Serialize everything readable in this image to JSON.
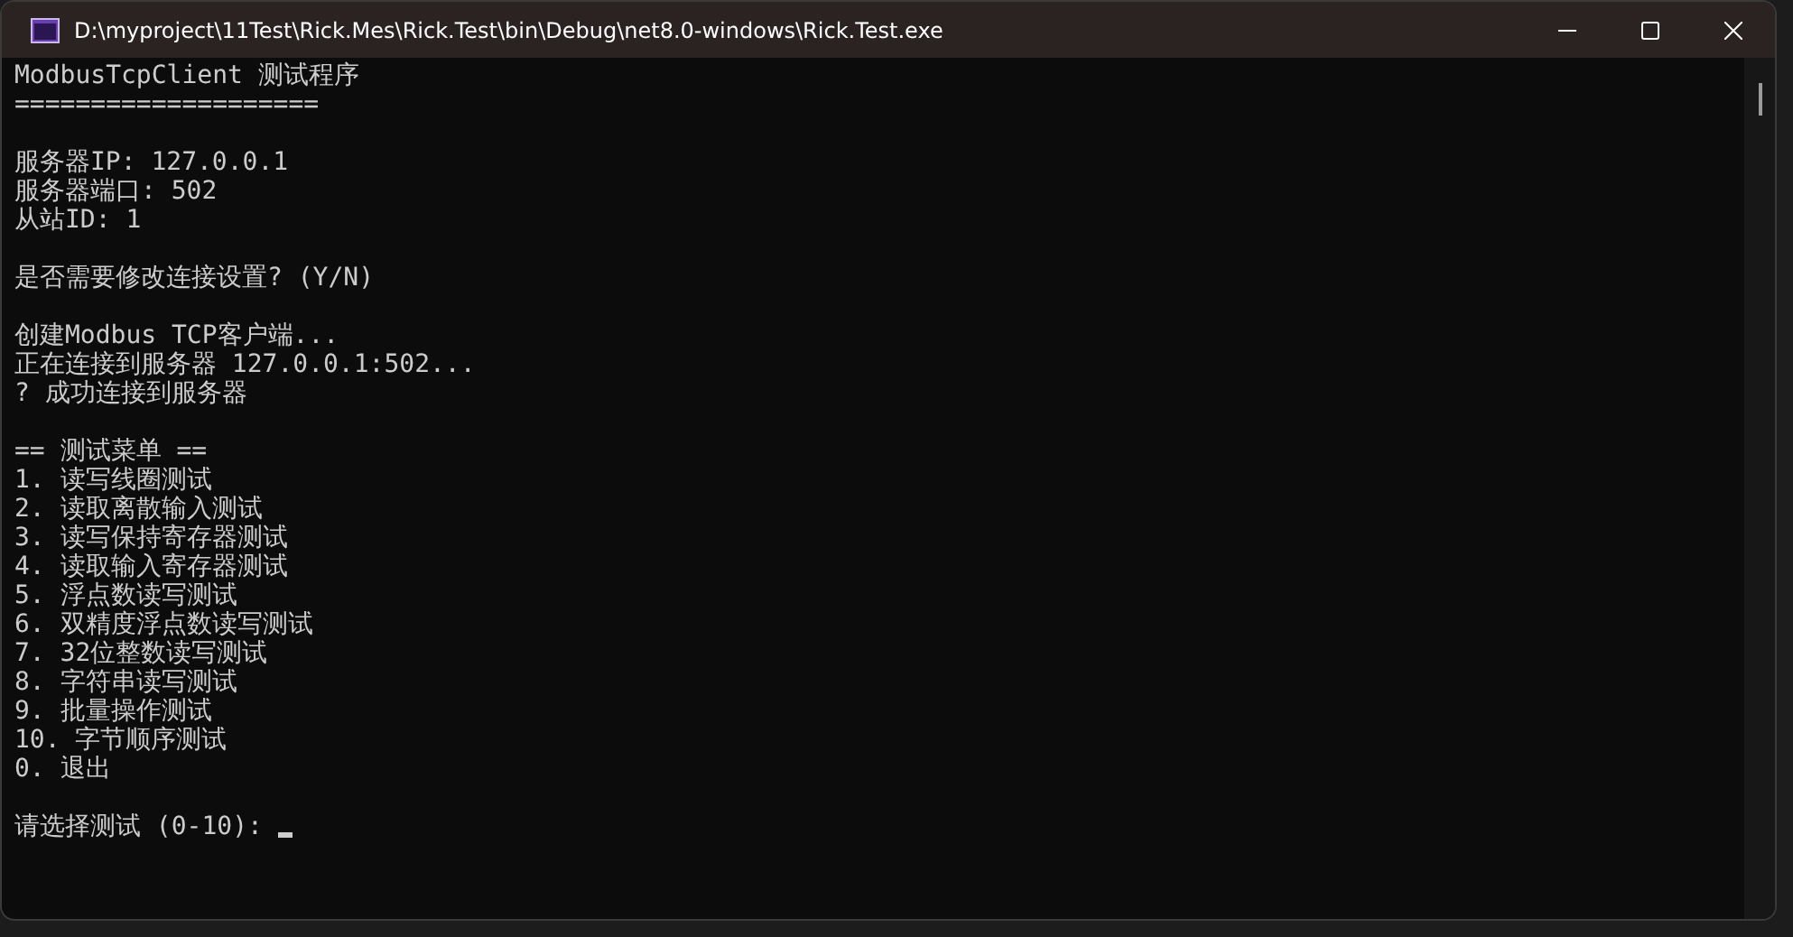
{
  "window": {
    "title": "D:\\myproject\\11Test\\Rick.Mes\\Rick.Test\\bin\\Debug\\net8.0-windows\\Rick.Test.exe"
  },
  "console": {
    "blocks": [
      [
        "ModbusTcpClient 测试程序",
        "===================="
      ],
      [
        "服务器IP: 127.0.0.1",
        "服务器端口: 502",
        "从站ID: 1"
      ],
      [
        "是否需要修改连接设置? (Y/N)"
      ],
      [
        "创建Modbus TCP客户端...",
        "正在连接到服务器 127.0.0.1:502...",
        "? 成功连接到服务器"
      ],
      [
        "== 测试菜单 ==",
        "1. 读写线圈测试",
        "2. 读取离散输入测试",
        "3. 读写保持寄存器测试",
        "4. 读取输入寄存器测试",
        "5. 浮点数读写测试",
        "6. 双精度浮点数读写测试",
        "7. 32位整数读写测试",
        "8. 字符串读写测试",
        "9. 批量操作测试",
        "10. 字节顺序测试",
        "0. 退出"
      ]
    ],
    "prompt": "请选择测试 (0-10):"
  }
}
